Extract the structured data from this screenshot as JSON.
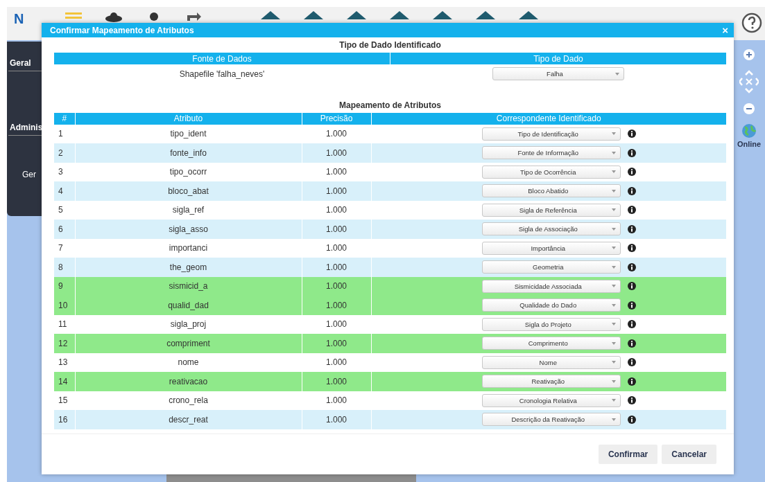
{
  "app": {
    "logo": "N"
  },
  "sidebar": {
    "items": [
      {
        "label": "Geral"
      },
      {
        "label": "Adminis"
      },
      {
        "label": "Ger"
      }
    ]
  },
  "right_rail": {
    "status": "Online"
  },
  "dialog": {
    "title": "Confirmar Mapeamento de Atributos",
    "close": "×",
    "data_type_section": {
      "title": "Tipo de Dado Identificado",
      "columns": [
        "Fonte de Dados",
        "Tipo de Dado"
      ],
      "source": "Shapefile 'falha_neves'",
      "type_value": "Falha"
    },
    "mapping_section": {
      "title": "Mapeamento de Atributos",
      "columns": [
        "#",
        "Atributo",
        "Precisão",
        "Correspondente Identificado"
      ],
      "rows": [
        {
          "index": "1",
          "attribute": "tipo_ident",
          "precision": "1.000",
          "match": "Tipo de Identificação",
          "highlighted": false
        },
        {
          "index": "2",
          "attribute": "fonte_info",
          "precision": "1.000",
          "match": "Fonte de Informação",
          "highlighted": false
        },
        {
          "index": "3",
          "attribute": "tipo_ocorr",
          "precision": "1.000",
          "match": "Tipo de Ocorrência",
          "highlighted": false
        },
        {
          "index": "4",
          "attribute": "bloco_abat",
          "precision": "1.000",
          "match": "Bloco Abatido",
          "highlighted": false
        },
        {
          "index": "5",
          "attribute": "sigla_ref",
          "precision": "1.000",
          "match": "Sigla de Referência",
          "highlighted": false
        },
        {
          "index": "6",
          "attribute": "sigla_asso",
          "precision": "1.000",
          "match": "Sigla de Associação",
          "highlighted": false
        },
        {
          "index": "7",
          "attribute": "importanci",
          "precision": "1.000",
          "match": "Importância",
          "highlighted": false
        },
        {
          "index": "8",
          "attribute": "the_geom",
          "precision": "1.000",
          "match": "Geometria",
          "highlighted": false
        },
        {
          "index": "9",
          "attribute": "sismicid_a",
          "precision": "1.000",
          "match": "Sismicidade Associada",
          "highlighted": true
        },
        {
          "index": "10",
          "attribute": "qualid_dad",
          "precision": "1.000",
          "match": "Qualidade do Dado",
          "highlighted": true
        },
        {
          "index": "11",
          "attribute": "sigla_proj",
          "precision": "1.000",
          "match": "Sigla do Projeto",
          "highlighted": false
        },
        {
          "index": "12",
          "attribute": "compriment",
          "precision": "1.000",
          "match": "Comprimento",
          "highlighted": true
        },
        {
          "index": "13",
          "attribute": "nome",
          "precision": "1.000",
          "match": "Nome",
          "highlighted": false
        },
        {
          "index": "14",
          "attribute": "reativacao",
          "precision": "1.000",
          "match": "Reativação",
          "highlighted": true
        },
        {
          "index": "15",
          "attribute": "crono_rela",
          "precision": "1.000",
          "match": "Cronologia Relativa",
          "highlighted": false
        },
        {
          "index": "16",
          "attribute": "descr_reat",
          "precision": "1.000",
          "match": "Descrição da Reativação",
          "highlighted": false
        }
      ]
    },
    "buttons": [
      "Confirmar",
      "Cancelar"
    ]
  }
}
